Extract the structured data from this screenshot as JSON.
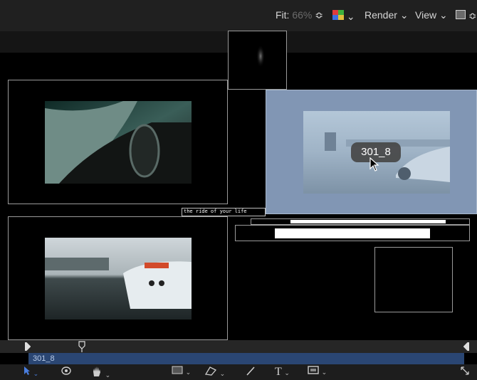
{
  "toolbar": {
    "fit_label": "Fit:",
    "fit_value": "66%",
    "fit_stepper": "≎",
    "render_label": "Render",
    "view_label": "View",
    "chevron": "⌄"
  },
  "canvas": {
    "lower_third_text": "the ride of your life",
    "tooltip_text": "301_8"
  },
  "timeline": {
    "clip_name": "301_8"
  },
  "bottom_tools": {
    "select_chevron": "⌄",
    "hand_chevron": "⌄",
    "shape_chevron": "⌄",
    "mask_chevron": "⌄",
    "text_glyph": "T",
    "text_chevron": "⌄",
    "frame_chevron": "⌄"
  },
  "colors": {
    "accent_blue": "#2a4673",
    "selected_tint": "#8196b4",
    "tool_select": "#4a7fe0"
  }
}
